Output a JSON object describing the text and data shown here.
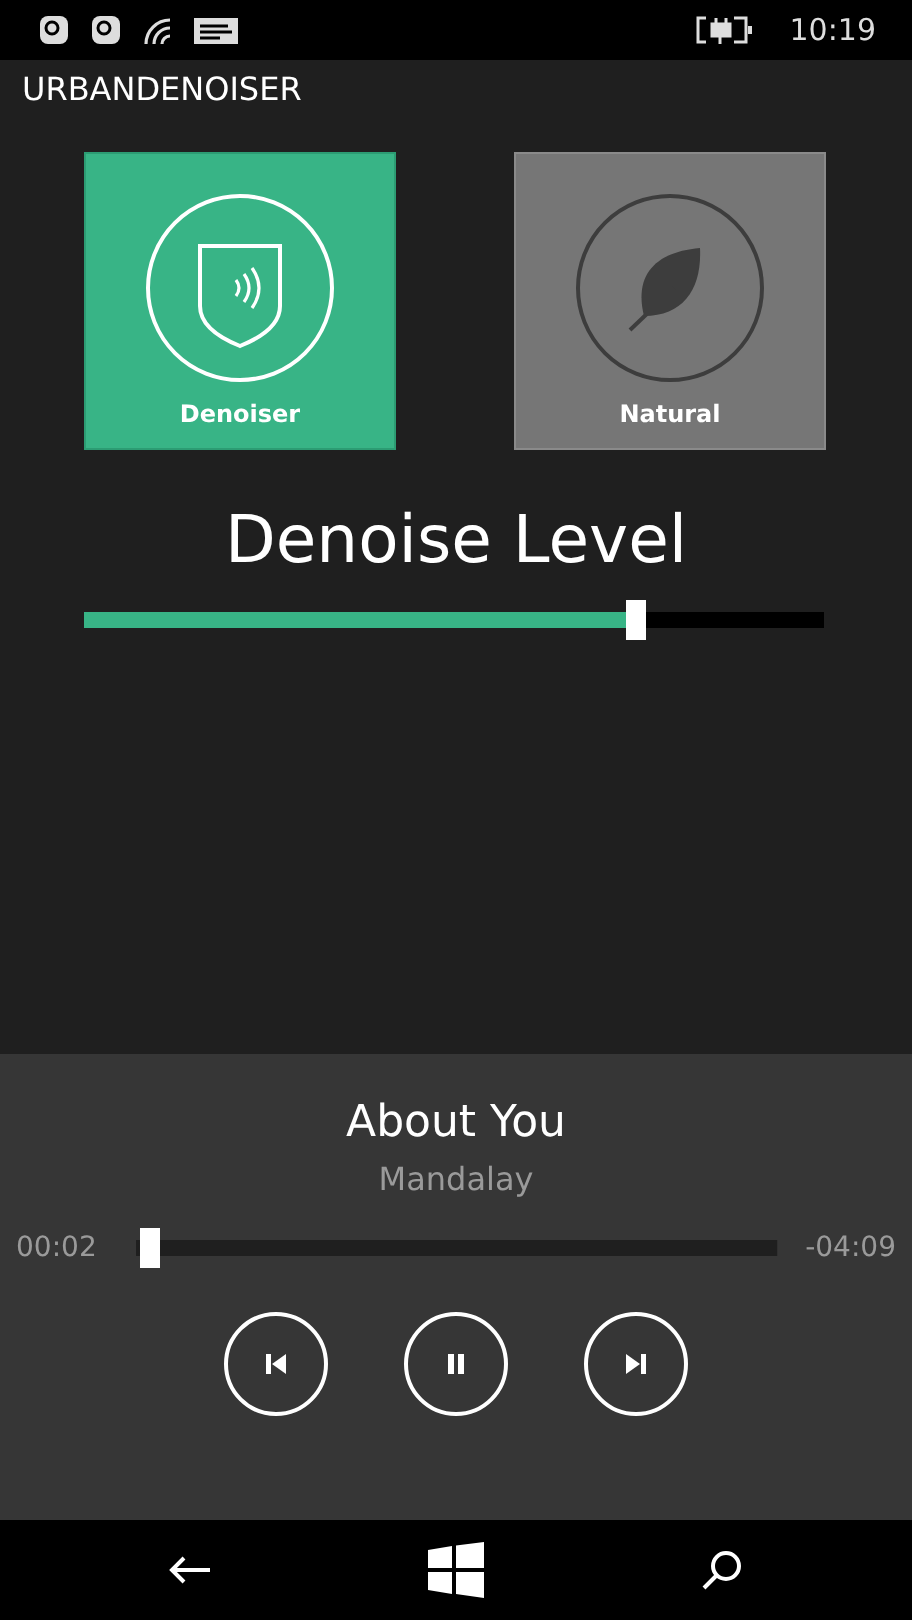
{
  "status_bar": {
    "time": "10:19"
  },
  "app_title": "URBANDENOISER",
  "modes": [
    {
      "label": "Denoiser",
      "kind": "shield",
      "selected": true
    },
    {
      "label": "Natural",
      "kind": "leaf",
      "selected": false
    }
  ],
  "denoise": {
    "title": "Denoise Level",
    "level": 0.745
  },
  "player": {
    "title": "About You",
    "artist": "Mandalay",
    "elapsed": "00:02",
    "remaining": "-04:09",
    "level": 0.02,
    "playing": true
  }
}
